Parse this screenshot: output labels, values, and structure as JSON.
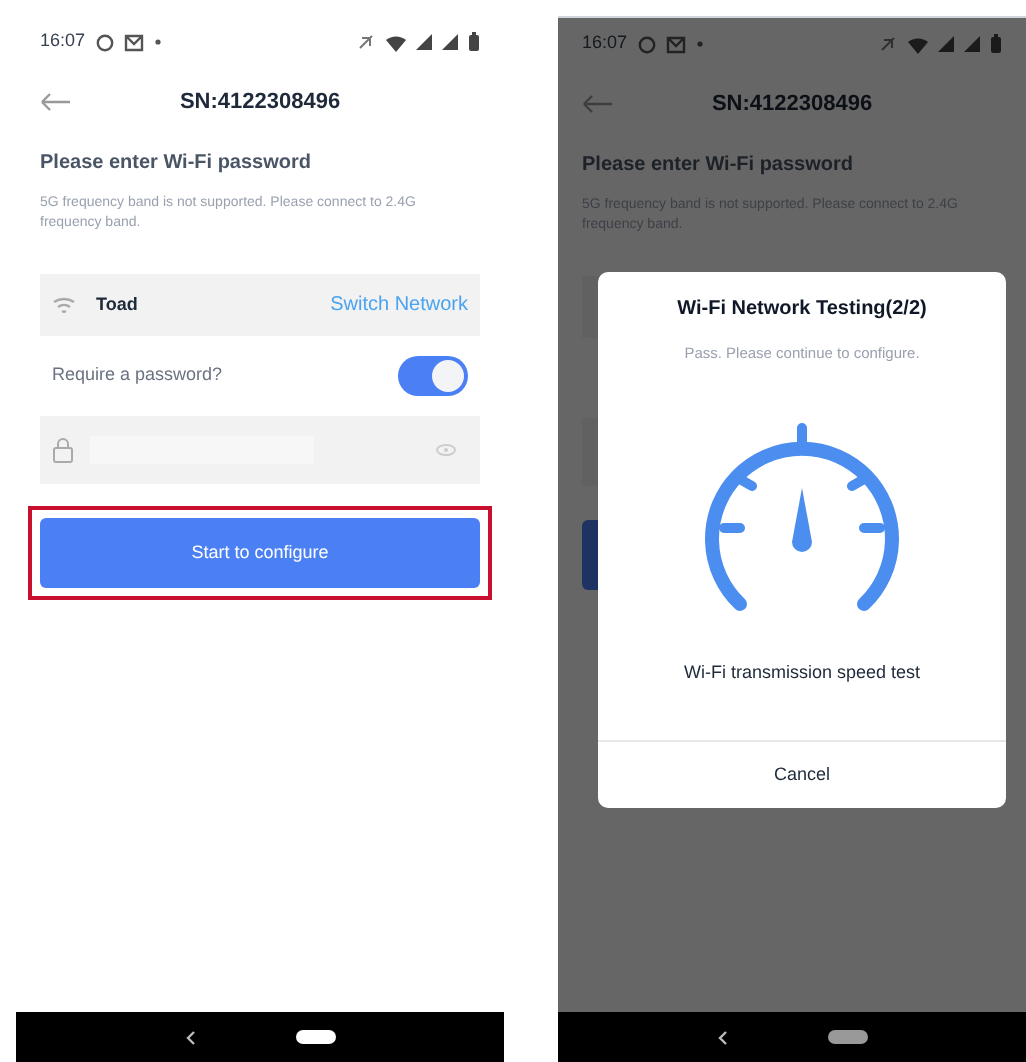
{
  "screens": [
    {
      "dimmed": false,
      "status_bar": {
        "time": "16:07"
      },
      "title": "SN:4122308496",
      "heading": "Please enter Wi-Fi password",
      "note": "5G frequency band is not supported. Please connect to 2.4G frequency band.",
      "network": {
        "name": "Toad",
        "action": "Switch Network"
      },
      "password_toggle": {
        "label": "Require a password?",
        "on": true
      },
      "button": {
        "label": "Start to configure",
        "highlighted": true
      }
    },
    {
      "dimmed": true,
      "status_bar": {
        "time": "16:07"
      },
      "title": "SN:4122308496",
      "heading": "Please enter Wi-Fi password",
      "note": "5G frequency band is not supported. Please connect to 2.4G frequency band.",
      "dialog": {
        "title": "Wi-Fi Network Testing(2/2)",
        "subtitle": "Pass. Please continue to configure.",
        "caption": "Wi-Fi transmission speed test",
        "cancel": "Cancel"
      }
    }
  ]
}
